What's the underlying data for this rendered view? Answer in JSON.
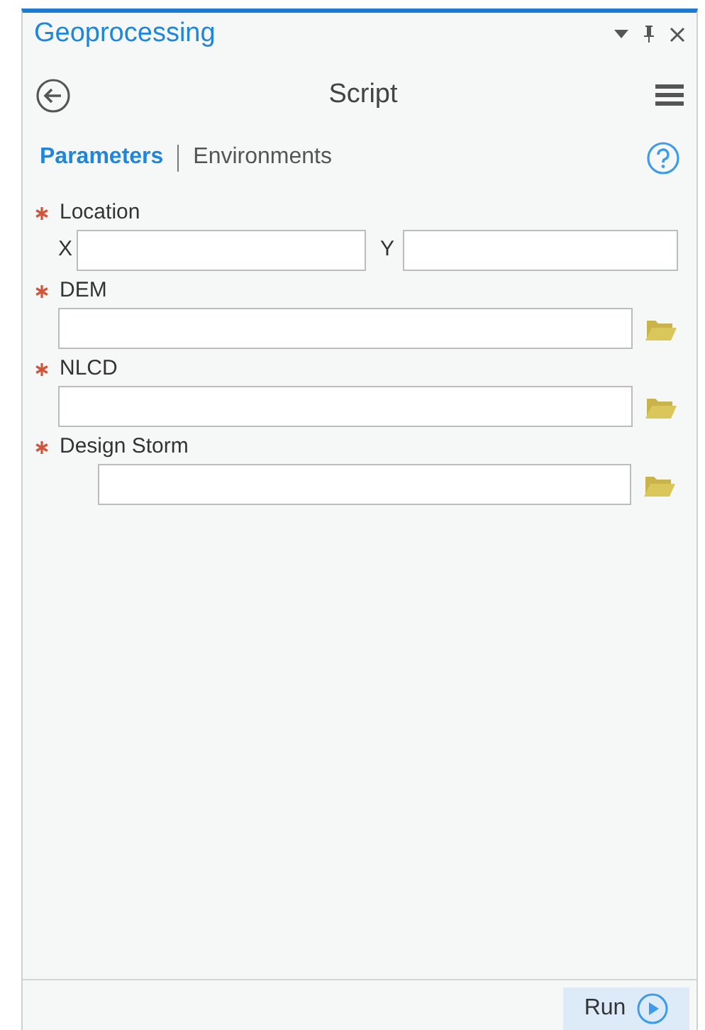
{
  "pane": {
    "title": "Geoprocessing"
  },
  "tool": {
    "title": "Script"
  },
  "tabs": [
    {
      "label": "Parameters",
      "selected": true
    },
    {
      "label": "Environments",
      "selected": false
    }
  ],
  "parameters": [
    {
      "kind": "xy",
      "label": "Location",
      "required": true,
      "x_label": "X",
      "y_label": "Y"
    },
    {
      "kind": "file",
      "label": "DEM",
      "required": true,
      "indented": false
    },
    {
      "kind": "file",
      "label": "NLCD",
      "required": true,
      "indented": false
    },
    {
      "kind": "file",
      "label": "Design Storm",
      "required": true,
      "indented": true
    }
  ],
  "run_button": {
    "label": "Run"
  }
}
